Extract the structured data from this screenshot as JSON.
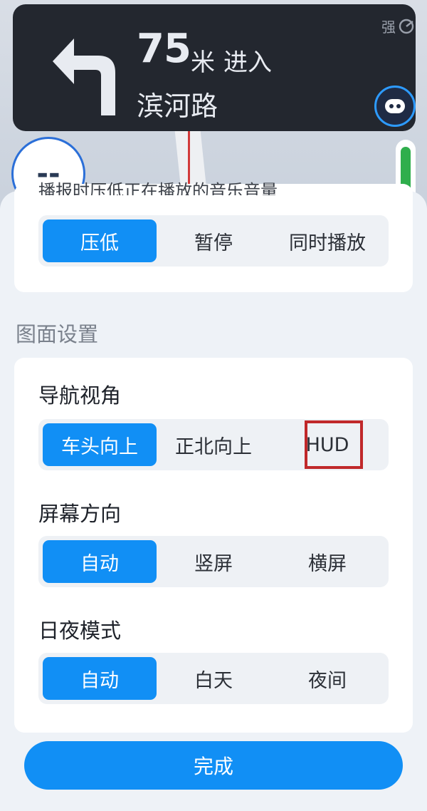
{
  "nav": {
    "distance": "75",
    "unit": "米",
    "action": "进入",
    "road": "滨河路",
    "signal_label": "强",
    "speed_text": "--"
  },
  "sheet": {
    "clipped_text": "播报时压低正在播放的音乐音量",
    "broadcast_options": [
      "压低",
      "暂停",
      "同时播放"
    ],
    "section_title": "图面设置",
    "view": {
      "label": "导航视角",
      "options": [
        "车头向上",
        "正北向上",
        "HUD"
      ]
    },
    "orientation": {
      "label": "屏幕方向",
      "options": [
        "自动",
        "竖屏",
        "横屏"
      ]
    },
    "daynight": {
      "label": "日夜模式",
      "options": [
        "自动",
        "白天",
        "夜间"
      ]
    },
    "done_label": "完成"
  },
  "colors": {
    "accent": "#118ff5",
    "highlight_box": "#c0282a",
    "banner": "#23272f"
  }
}
